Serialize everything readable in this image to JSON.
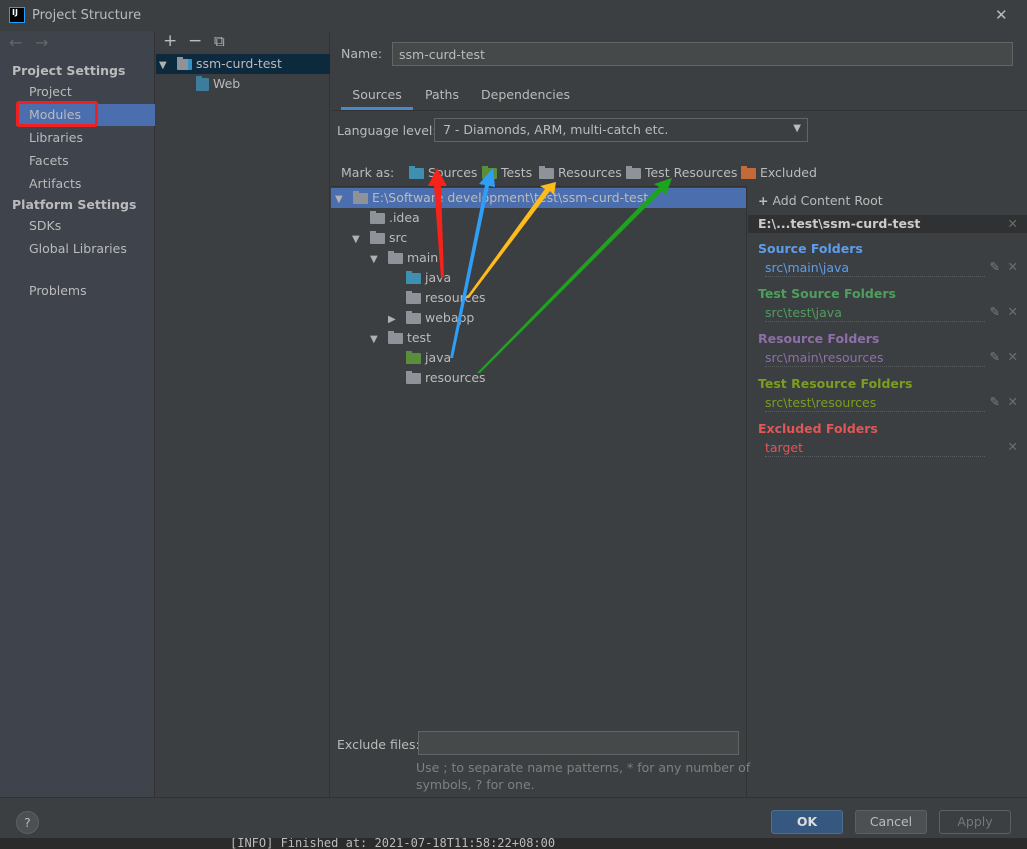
{
  "window": {
    "title": "Project Structure",
    "close": "✕",
    "logo": "IJ"
  },
  "sidebar": {
    "back": "←",
    "forward": "→",
    "project_settings": "Project Settings",
    "items": [
      "Project",
      "Modules",
      "Libraries",
      "Facets",
      "Artifacts"
    ],
    "platform_settings": "Platform Settings",
    "platform_items": [
      "SDKs",
      "Global Libraries"
    ],
    "problems": "Problems",
    "selected": "Modules"
  },
  "modules": {
    "toolbar": {
      "add": "+",
      "remove": "−",
      "copy": "⧉"
    },
    "tree": [
      {
        "label": "ssm-curd-test",
        "selected": true
      },
      {
        "label": "Web"
      }
    ]
  },
  "main": {
    "name_label": "Name:",
    "name_value": "ssm-curd-test",
    "tabs": [
      "Sources",
      "Paths",
      "Dependencies"
    ],
    "active_tab": "Sources",
    "language_label": "Language level:",
    "language_value": "7 - Diamonds, ARM, multi-catch etc.",
    "mark_as": "Mark as:",
    "mark_buttons": [
      "Sources",
      "Tests",
      "Resources",
      "Test Resources",
      "Excluded"
    ],
    "tree": {
      "root": "E:\\Software development\\test\\ssm-curd-test",
      "nodes": [
        ".idea",
        "src",
        "main",
        "java",
        "resources",
        "webapp",
        "test",
        "java",
        "resources"
      ]
    },
    "exclude_label": "Exclude files:",
    "exclude_value": "",
    "exclude_hint_1": "Use ; to separate name patterns, * for any number of",
    "exclude_hint_2": "symbols, ? for one."
  },
  "roots": {
    "add": "Add Content Root",
    "root": "E:\\...test\\ssm-curd-test",
    "groups": [
      {
        "title": "Source Folders",
        "path": "src\\main\\java",
        "color": "#5c9ded"
      },
      {
        "title": "Test Source Folders",
        "path": "src\\test\\java",
        "color": "#4f9e5e"
      },
      {
        "title": "Resource Folders",
        "path": "src\\main\\resources",
        "color": "#8e6eaa"
      },
      {
        "title": "Test Resource Folders",
        "path": "src\\test\\resources",
        "color": "#7b9e1e"
      },
      {
        "title": "Excluded Folders",
        "path": "target",
        "color": "#e25656"
      }
    ]
  },
  "footer": {
    "help": "?",
    "ok": "OK",
    "cancel": "Cancel",
    "apply": "Apply"
  },
  "background_text": "[INFO] Finished at: 2021-07-18T11:58:22+08:00",
  "colors": {
    "selection": "#4b6eaf",
    "sources": "#3f8fb0",
    "tests": "#5a8e3d",
    "excluded": "#c26a3a",
    "ok": "#365880"
  }
}
